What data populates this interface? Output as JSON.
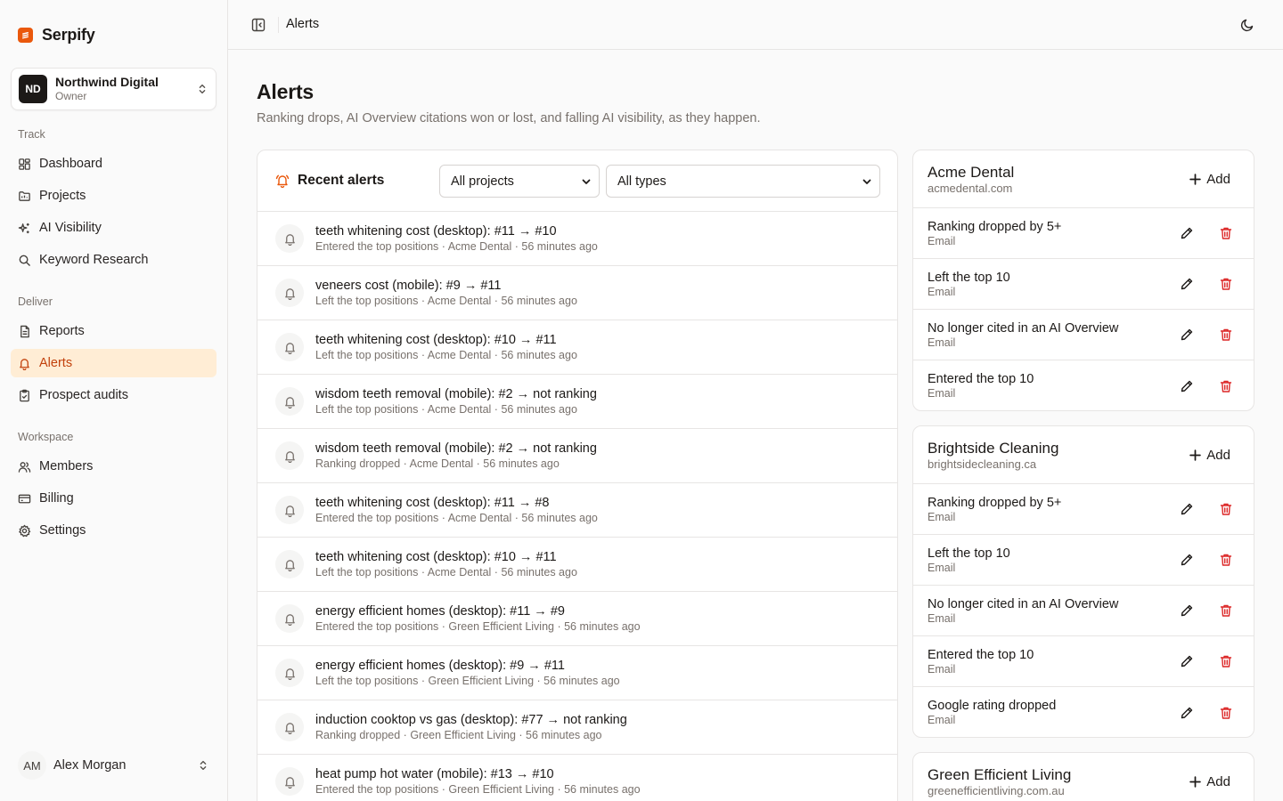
{
  "brand": {
    "name": "Serpify",
    "accent": "#ea580c"
  },
  "org": {
    "initials": "ND",
    "name": "Northwind Digital",
    "role": "Owner"
  },
  "nav": {
    "track_label": "Track",
    "deliver_label": "Deliver",
    "workspace_label": "Workspace",
    "items": [
      {
        "label": "Dashboard",
        "icon": "dashboard-icon"
      },
      {
        "label": "Projects",
        "icon": "folder-icon"
      },
      {
        "label": "AI Visibility",
        "icon": "sparkles-icon"
      },
      {
        "label": "Keyword Research",
        "icon": "search-icon"
      },
      {
        "label": "Reports",
        "icon": "report-icon"
      },
      {
        "label": "Alerts",
        "icon": "bell-icon",
        "active": true
      },
      {
        "label": "Prospect audits",
        "icon": "clipboard-icon"
      },
      {
        "label": "Members",
        "icon": "users-icon"
      },
      {
        "label": "Billing",
        "icon": "credit-card-icon"
      },
      {
        "label": "Settings",
        "icon": "gear-icon"
      }
    ]
  },
  "user": {
    "initials": "AM",
    "name": "Alex Morgan"
  },
  "header": {
    "breadcrumb": "Alerts"
  },
  "page": {
    "title": "Alerts",
    "subtitle": "Ranking drops, AI Overview citations won or lost, and falling AI visibility, as they happen."
  },
  "recent": {
    "title": "Recent alerts",
    "project_filter": "All projects",
    "type_filter": "All types",
    "alerts": [
      {
        "title": "teeth whitening cost (desktop): #11 → #10",
        "meta": "Entered the top positions · Acme Dental · 56 minutes ago"
      },
      {
        "title": "veneers cost (mobile): #9 → #11",
        "meta": "Left the top positions · Acme Dental · 56 minutes ago"
      },
      {
        "title": "teeth whitening cost (desktop): #10 → #11",
        "meta": "Left the top positions · Acme Dental · 56 minutes ago"
      },
      {
        "title": "wisdom teeth removal (mobile): #2 → not ranking",
        "meta": "Left the top positions · Acme Dental · 56 minutes ago"
      },
      {
        "title": "wisdom teeth removal (mobile): #2 → not ranking",
        "meta": "Ranking dropped · Acme Dental · 56 minutes ago"
      },
      {
        "title": "teeth whitening cost (desktop): #11 → #8",
        "meta": "Entered the top positions · Acme Dental · 56 minutes ago"
      },
      {
        "title": "teeth whitening cost (desktop): #10 → #11",
        "meta": "Left the top positions · Acme Dental · 56 minutes ago"
      },
      {
        "title": "energy efficient homes (desktop): #11 → #9",
        "meta": "Entered the top positions · Green Efficient Living · 56 minutes ago"
      },
      {
        "title": "energy efficient homes (desktop): #9 → #11",
        "meta": "Left the top positions · Green Efficient Living · 56 minutes ago"
      },
      {
        "title": "induction cooktop vs gas (desktop): #77 → not ranking",
        "meta": "Ranking dropped · Green Efficient Living · 56 minutes ago"
      },
      {
        "title": "heat pump hot water (mobile): #13 → #10",
        "meta": "Entered the top positions · Green Efficient Living · 56 minutes ago"
      }
    ]
  },
  "add_label": "Add",
  "projects": [
    {
      "name": "Acme Dental",
      "domain": "acmedental.com",
      "rules": [
        {
          "name": "Ranking dropped by 5+",
          "channel": "Email"
        },
        {
          "name": "Left the top 10",
          "channel": "Email"
        },
        {
          "name": "No longer cited in an AI Overview",
          "channel": "Email"
        },
        {
          "name": "Entered the top 10",
          "channel": "Email"
        }
      ]
    },
    {
      "name": "Brightside Cleaning",
      "domain": "brightsidecleaning.ca",
      "rules": [
        {
          "name": "Ranking dropped by 5+",
          "channel": "Email"
        },
        {
          "name": "Left the top 10",
          "channel": "Email"
        },
        {
          "name": "No longer cited in an AI Overview",
          "channel": "Email"
        },
        {
          "name": "Entered the top 10",
          "channel": "Email"
        },
        {
          "name": "Google rating dropped",
          "channel": "Email"
        }
      ]
    },
    {
      "name": "Green Efficient Living",
      "domain": "greenefficientliving.com.au",
      "rules": []
    }
  ]
}
